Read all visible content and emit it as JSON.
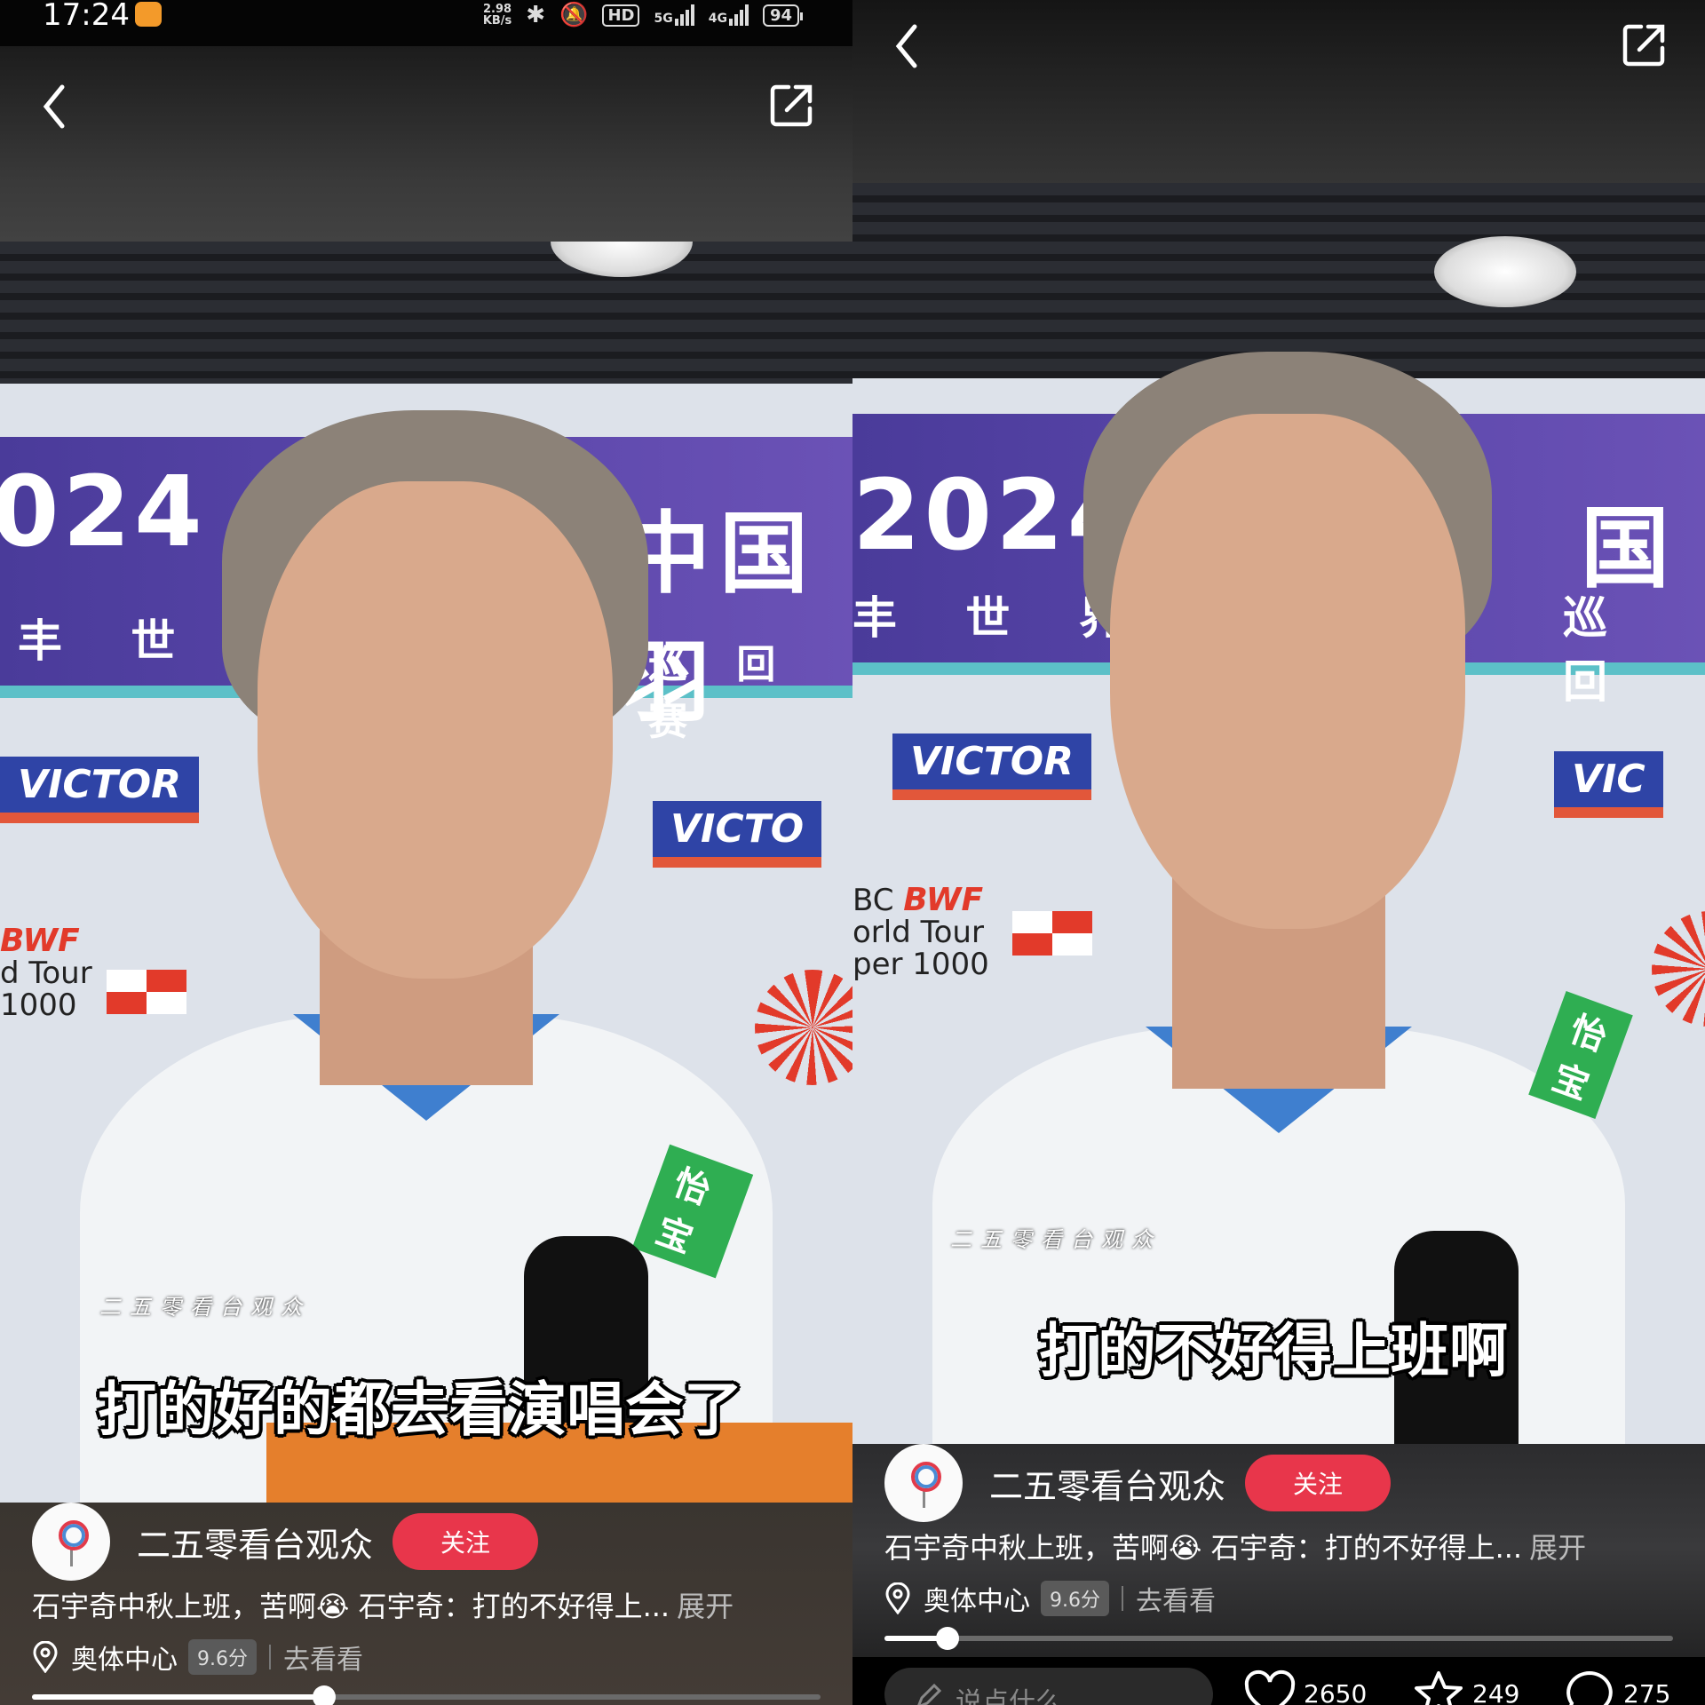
{
  "status_bar": {
    "time": "17:24",
    "net_speed_value": "2.98",
    "net_speed_unit": "KB/s",
    "hd_label": "HD",
    "sig1_label": "5G",
    "sig2_label": "4G",
    "battery": "94"
  },
  "left": {
    "banner": {
      "year": "024",
      "cn_top": "中国羽",
      "cn_line": "丰 世 界",
      "cn_sub": "巡 回 赛",
      "victor": "VICTOR",
      "victor2": "VICTO",
      "bwf_brand": "BWF",
      "bwf_tour": "d Tour",
      "bwf_level": "1000",
      "patch": "怡宝"
    },
    "watermark": "二五零看台观众",
    "subtitle": "打的好的都去看演唱会了",
    "author": "二五零看台观众",
    "follow": "关注",
    "description": "石宇奇中秋上班，苦啊😭 石宇奇：打的不好得上...",
    "expand": "展开",
    "location": "奥体中心",
    "rating": "9.6分",
    "go_see": "去看看",
    "progress": 0.37
  },
  "right": {
    "banner": {
      "year": "2024",
      "cn_top": "国",
      "cn_line": "丰 世 界",
      "cn_sub": "巡 回",
      "victor": "VICTOR",
      "victor2": "VIC",
      "bwf_brand": "BWF",
      "bwf_hsbc": "BC",
      "bwf_tour": "orld Tour",
      "bwf_level": "per 1000",
      "patch": "怡宝"
    },
    "watermark": "二五零看台观众",
    "subtitle": "打的不好得上班啊",
    "author": "二五零看台观众",
    "follow": "关注",
    "description": "石宇奇中秋上班，苦啊😭 石宇奇：打的不好得上...",
    "expand": "展开",
    "location": "奥体中心",
    "rating": "9.6分",
    "go_see": "去看看",
    "progress": 0.08,
    "comment_placeholder": "说点什么",
    "likes": "2650",
    "favorites": "249",
    "comments": "275"
  },
  "colors": {
    "accent": "#e8364b",
    "banner_purple": "#4a3b9a",
    "victor_blue": "#2f44a6"
  }
}
